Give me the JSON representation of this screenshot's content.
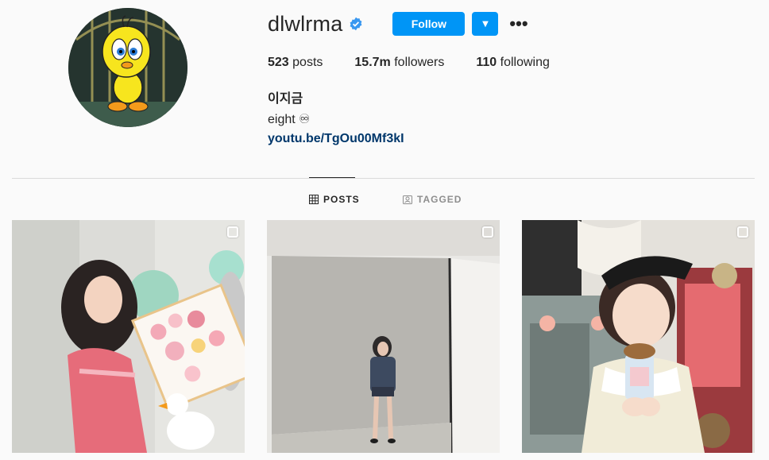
{
  "profile": {
    "username": "dlwlrma",
    "verified": true,
    "follow_label": "Follow",
    "dropdown_icon": "caret-down-icon",
    "more_icon": "more-options-icon",
    "more_glyph": "•••",
    "dropdown_glyph": "▼",
    "avatar_description": "tweety-bird-avatar"
  },
  "stats": {
    "posts_count": "523",
    "posts_label": "posts",
    "followers_count": "15.7m",
    "followers_label": "followers",
    "following_count": "110",
    "following_label": "following"
  },
  "bio": {
    "full_name": "이지금",
    "text": "eight ♾",
    "link": "youtu.be/TgOu00Mf3kI"
  },
  "tabs": [
    {
      "label": "POSTS",
      "icon": "grid-icon",
      "active": true
    },
    {
      "label": "TAGGED",
      "icon": "tagged-icon",
      "active": false
    }
  ],
  "posts": [
    {
      "type": "multi-photo",
      "icon": "carousel-icon"
    },
    {
      "type": "multi-photo",
      "icon": "carousel-icon"
    },
    {
      "type": "multi-photo",
      "icon": "carousel-icon"
    }
  ],
  "colors": {
    "accent": "#0095f6",
    "link": "#00376b",
    "background": "#fafafa",
    "border": "#dbdbdb",
    "muted": "#8e8e8e"
  }
}
